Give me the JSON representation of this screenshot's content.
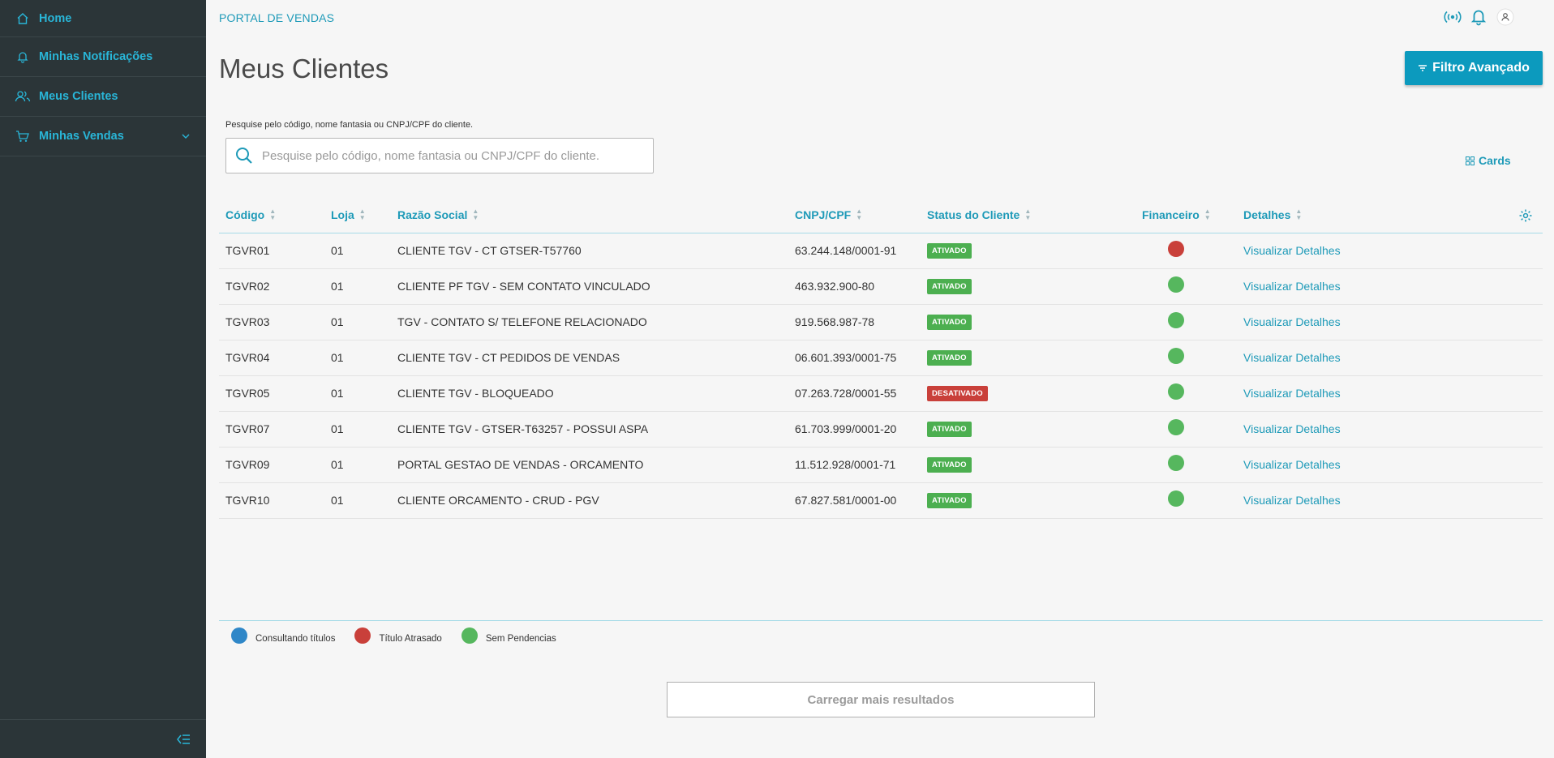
{
  "sidebar": {
    "items": [
      {
        "label": "Home",
        "icon": "home-icon"
      },
      {
        "label": "Minhas Notificações",
        "icon": "bell-icon"
      },
      {
        "label": "Meus Clientes",
        "icon": "users-icon"
      },
      {
        "label": "Minhas Vendas",
        "icon": "cart-icon",
        "has_submenu": true
      }
    ]
  },
  "header": {
    "portal_title": "PORTAL DE VENDAS"
  },
  "page": {
    "title": "Meus Clientes",
    "filter_button": "Filtro Avançado",
    "search_label": "Pesquise pelo código, nome fantasia ou CNPJ/CPF do cliente.",
    "search_placeholder": "Pesquise pelo código, nome fantasia ou CNPJ/CPF do cliente.",
    "search_value": "",
    "view_toggle": "Cards"
  },
  "table": {
    "columns": [
      "Código",
      "Loja",
      "Razão Social",
      "CNPJ/CPF",
      "Status do Cliente",
      "Financeiro",
      "Detalhes"
    ],
    "rows": [
      {
        "codigo": "TGVR01",
        "loja": "01",
        "razao": "CLIENTE TGV - CT GTSER-T57760",
        "cnpj": "63.244.148/0001-91",
        "status": "ATIVADO",
        "financeiro": "red",
        "detalhes": "Visualizar Detalhes"
      },
      {
        "codigo": "TGVR02",
        "loja": "01",
        "razao": "CLIENTE PF TGV - SEM CONTATO VINCULADO",
        "cnpj": "463.932.900-80",
        "status": "ATIVADO",
        "financeiro": "green",
        "detalhes": "Visualizar Detalhes"
      },
      {
        "codigo": "TGVR03",
        "loja": "01",
        "razao": "TGV - CONTATO S/ TELEFONE RELACIONADO",
        "cnpj": "919.568.987-78",
        "status": "ATIVADO",
        "financeiro": "green",
        "detalhes": "Visualizar Detalhes"
      },
      {
        "codigo": "TGVR04",
        "loja": "01",
        "razao": "CLIENTE TGV - CT PEDIDOS DE VENDAS",
        "cnpj": "06.601.393/0001-75",
        "status": "ATIVADO",
        "financeiro": "green",
        "detalhes": "Visualizar Detalhes"
      },
      {
        "codigo": "TGVR05",
        "loja": "01",
        "razao": "CLIENTE TGV - BLOQUEADO",
        "cnpj": "07.263.728/0001-55",
        "status": "DESATIVADO",
        "financeiro": "green",
        "detalhes": "Visualizar Detalhes"
      },
      {
        "codigo": "TGVR07",
        "loja": "01",
        "razao": "CLIENTE TGV - GTSER-T63257 - POSSUI ASPA",
        "cnpj": "61.703.999/0001-20",
        "status": "ATIVADO",
        "financeiro": "green",
        "detalhes": "Visualizar Detalhes"
      },
      {
        "codigo": "TGVR09",
        "loja": "01",
        "razao": "PORTAL GESTAO DE VENDAS - ORCAMENTO",
        "cnpj": "11.512.928/0001-71",
        "status": "ATIVADO",
        "financeiro": "green",
        "detalhes": "Visualizar Detalhes"
      },
      {
        "codigo": "TGVR10",
        "loja": "01",
        "razao": "CLIENTE ORCAMENTO - CRUD - PGV",
        "cnpj": "67.827.581/0001-00",
        "status": "ATIVADO",
        "financeiro": "green",
        "detalhes": "Visualizar Detalhes"
      }
    ]
  },
  "legend": [
    {
      "label": "Consultando títulos",
      "color": "#2f87c8"
    },
    {
      "label": "Título Atrasado",
      "color": "#c9403a"
    },
    {
      "label": "Sem Pendencias",
      "color": "#56b75e"
    }
  ],
  "load_more": "Carregar mais resultados",
  "colors": {
    "accent": "#0c9abe",
    "link": "#1e9ab8",
    "sidebar_bg": "#2b3538",
    "status_active": "#4caf50",
    "status_inactive": "#c9403a",
    "dot_red": "#c9403a",
    "dot_green": "#56b75e"
  }
}
